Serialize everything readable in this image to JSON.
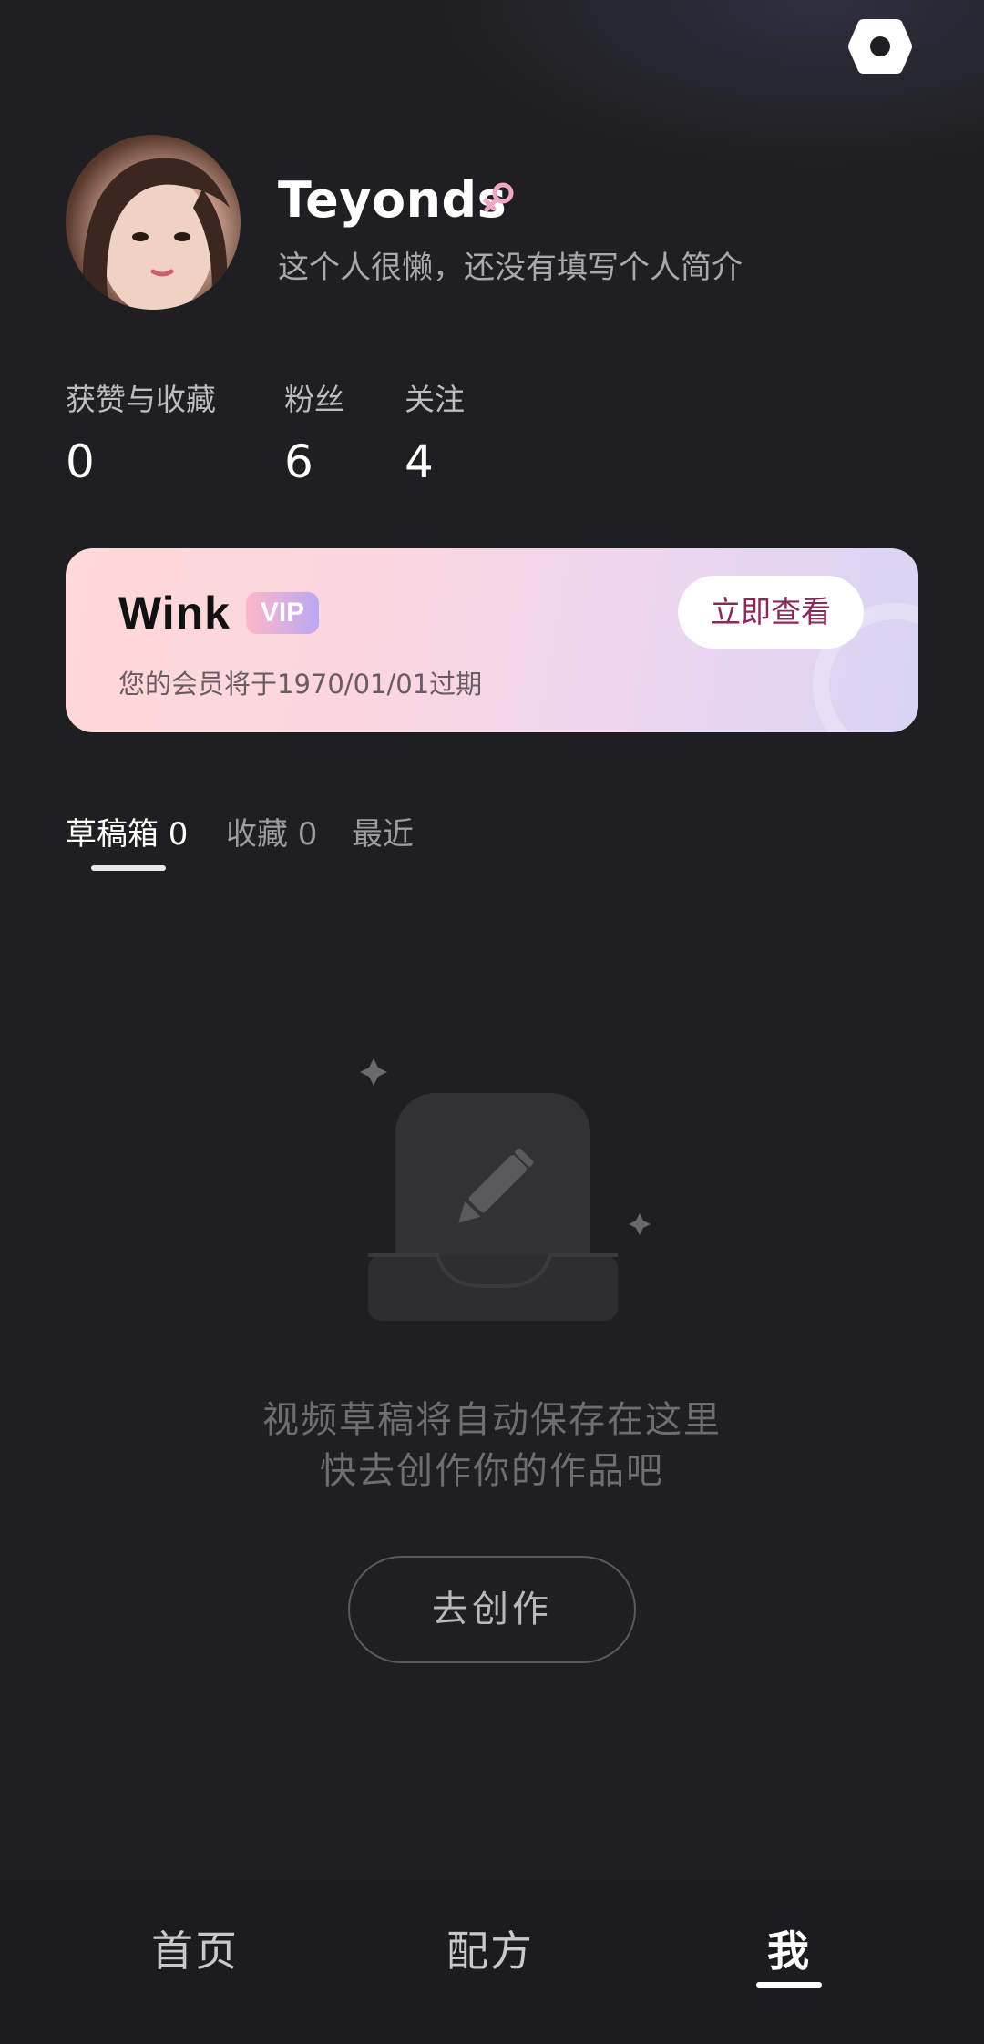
{
  "header": {
    "settings_icon": "settings-hexagon-icon"
  },
  "profile": {
    "username": "Teyonds",
    "gender_icon": "female-icon",
    "gender_color": "#f3a6c4",
    "bio": "这个人很懒，还没有填写个人简介"
  },
  "stats": [
    {
      "label": "获赞与收藏",
      "value": "0"
    },
    {
      "label": "粉丝",
      "value": "6"
    },
    {
      "label": "关注",
      "value": "4"
    }
  ],
  "vip": {
    "brand": "Wink",
    "badge": "VIP",
    "expiry": "您的会员将于1970/01/01过期",
    "button_label": "立即查看"
  },
  "tabs": [
    {
      "label": "草稿箱 0",
      "active": true
    },
    {
      "label": "收藏 0",
      "active": false
    },
    {
      "label": "最近",
      "active": false
    }
  ],
  "empty_state": {
    "icon": "draft-box-pencil-icon",
    "line1": "视频草稿将自动保存在这里",
    "line2": "快去创作你的作品吧",
    "button_label": "去创作"
  },
  "bottom_nav": [
    {
      "label": "首页",
      "active": false
    },
    {
      "label": "配方",
      "active": false
    },
    {
      "label": "我",
      "active": true
    }
  ]
}
